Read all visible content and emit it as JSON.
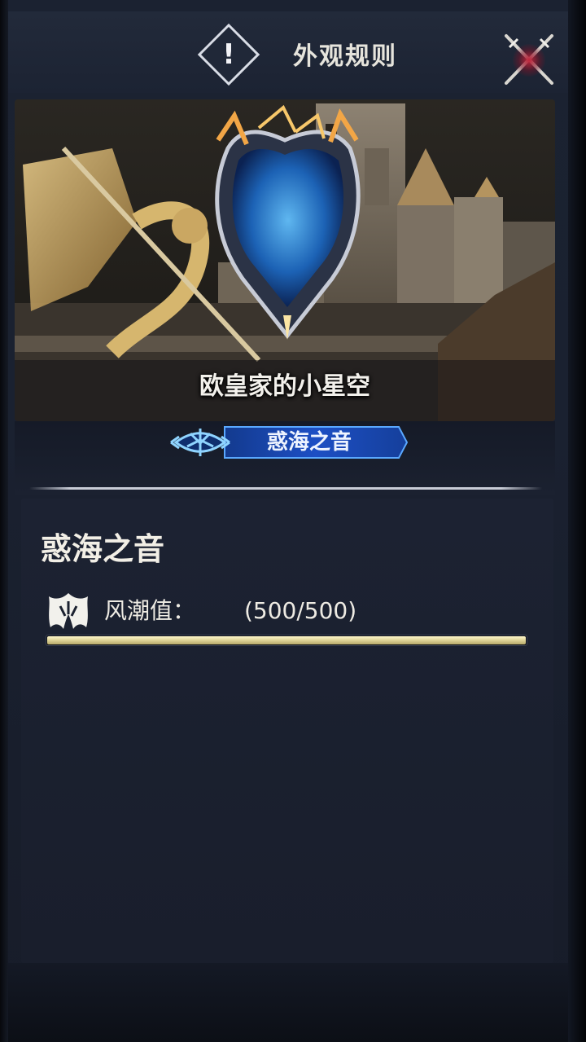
{
  "header": {
    "info_glyph": "!",
    "title": "外观规则"
  },
  "banner": {
    "player_name": "欧皇家的小星空",
    "skin_tag": "惑海之音"
  },
  "details": {
    "skin_name": "惑海之音",
    "stat_label": "风潮值：",
    "stat_value": "(500/500)",
    "progress_fraction": 1.0
  },
  "colors": {
    "accent_gold": "#e2d79b",
    "tag_blue": "#1d4fc4",
    "close_red": "#c0243a"
  },
  "icons": {
    "info": "exclamation-diamond-icon",
    "close": "crossed-swords-close-icon",
    "stat": "wind-tide-emblem-icon",
    "tag_emblem": "trident-crest-icon"
  }
}
